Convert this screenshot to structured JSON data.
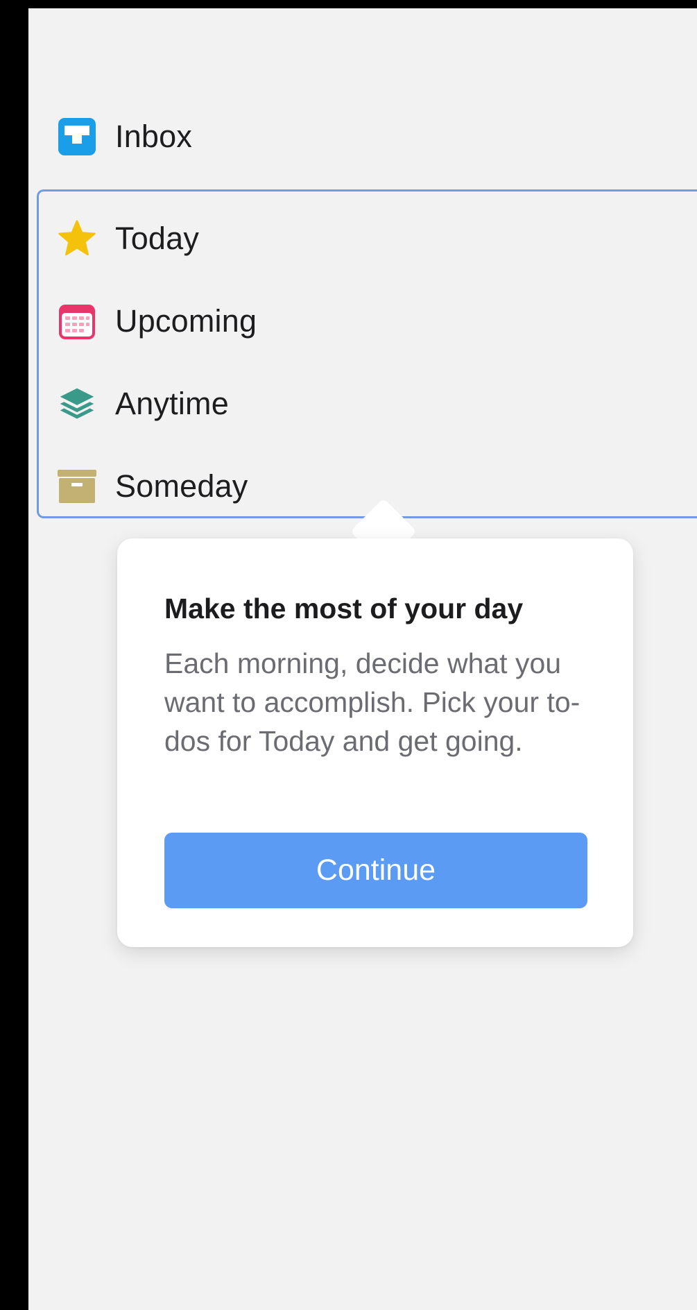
{
  "sidebar": {
    "inbox": {
      "label": "Inbox",
      "icon": "inbox-icon",
      "color": "#1b9ee8"
    },
    "items": [
      {
        "label": "Today",
        "icon": "star-icon",
        "color": "#f5c20b"
      },
      {
        "label": "Upcoming",
        "icon": "calendar-icon",
        "color": "#e8366b"
      },
      {
        "label": "Anytime",
        "icon": "layers-icon",
        "color": "#3a9a8a"
      },
      {
        "label": "Someday",
        "icon": "archive-box-icon",
        "color": "#c3b073"
      }
    ],
    "highlight_color": "#6f9be4"
  },
  "popover": {
    "title": "Make the most of your day",
    "body": "Each morning, decide what you want to accomplish. Pick your to-dos for Today and get going.",
    "continue_label": "Continue",
    "button_color": "#5c9bf4"
  }
}
